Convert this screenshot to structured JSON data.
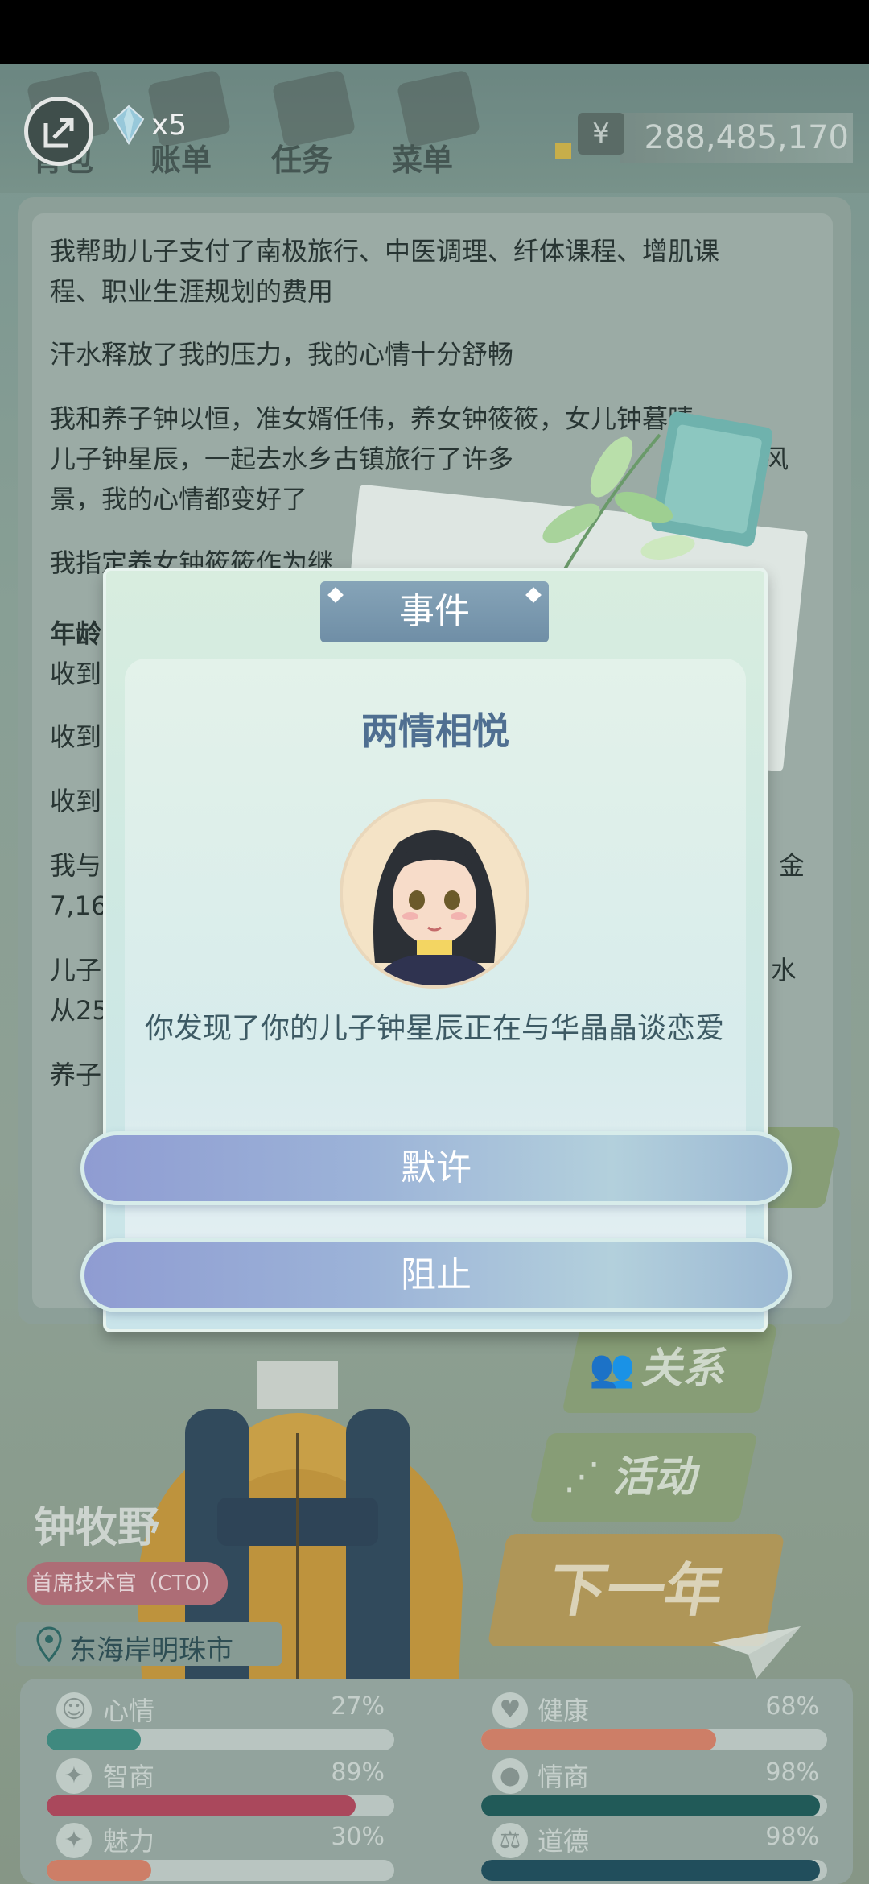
{
  "top": {
    "nav": [
      "背包",
      "账单",
      "任务",
      "菜单"
    ],
    "diamond_count": "x5",
    "money_symbol": "¥",
    "money": "288,485,170"
  },
  "log": {
    "line1a": "我帮助儿子支付了南极旅行、中医调理、纤体课程、增肌课",
    "line1b": "程、职业生涯规划的费用",
    "line2": "汗水释放了我的压力，我的心情十分舒畅",
    "line3a": "我和养子钟以恒，准女婿任伟，养女钟筱筱，女儿钟暮晴，",
    "line3b_left": "儿子钟星辰，一起去水乡古镇旅行了许多",
    "line3b_right": "优美的风",
    "line3c": "景，我的心情都变好了",
    "line4": "我指定养女钟筱筱作为继",
    "frag_age": "年龄",
    "frag_recv1": "收到",
    "frag_recv2": "收到",
    "frag_recv3": "收到",
    "frag_me": "我与",
    "frag_me_right": "金",
    "frag_num": "7,16",
    "frag_son": "儿子",
    "frag_son_right": "水",
    "frag_from": "从25",
    "frag_adopt": "养子"
  },
  "side_menu": {
    "relation": "关系",
    "activity": "活动",
    "next_year": "下一年"
  },
  "character": {
    "name": "钟牧野",
    "title": "首席技术官（CTO）",
    "location": "东海岸明珠市"
  },
  "stats": [
    {
      "label": "心情",
      "value": "27%",
      "fraction": 0.27,
      "color": "#3f8f84",
      "icon": "smile-icon",
      "glyph": "☺"
    },
    {
      "label": "健康",
      "value": "68%",
      "fraction": 0.68,
      "color": "#d9836a",
      "icon": "heart-icon",
      "glyph": "♥"
    },
    {
      "label": "智商",
      "value": "89%",
      "fraction": 0.89,
      "color": "#b3485e",
      "icon": "bulb-icon",
      "glyph": "✦"
    },
    {
      "label": "情商",
      "value": "98%",
      "fraction": 0.98,
      "color": "#1f5c5a",
      "icon": "apple-icon",
      "glyph": "●"
    },
    {
      "label": "魅力",
      "value": "30%",
      "fraction": 0.3,
      "color": "#d9836a",
      "icon": "sparkle-icon",
      "glyph": "✦"
    },
    {
      "label": "道德",
      "value": "98%",
      "fraction": 0.98,
      "color": "#1f4f5e",
      "icon": "scale-icon",
      "glyph": "⚖"
    }
  ],
  "dialog": {
    "tab": "事件",
    "title": "两情相悦",
    "text": "你发现了你的儿子钟星辰正在与华晶晶谈恋爱",
    "choices": [
      "默许",
      "阻止"
    ]
  }
}
